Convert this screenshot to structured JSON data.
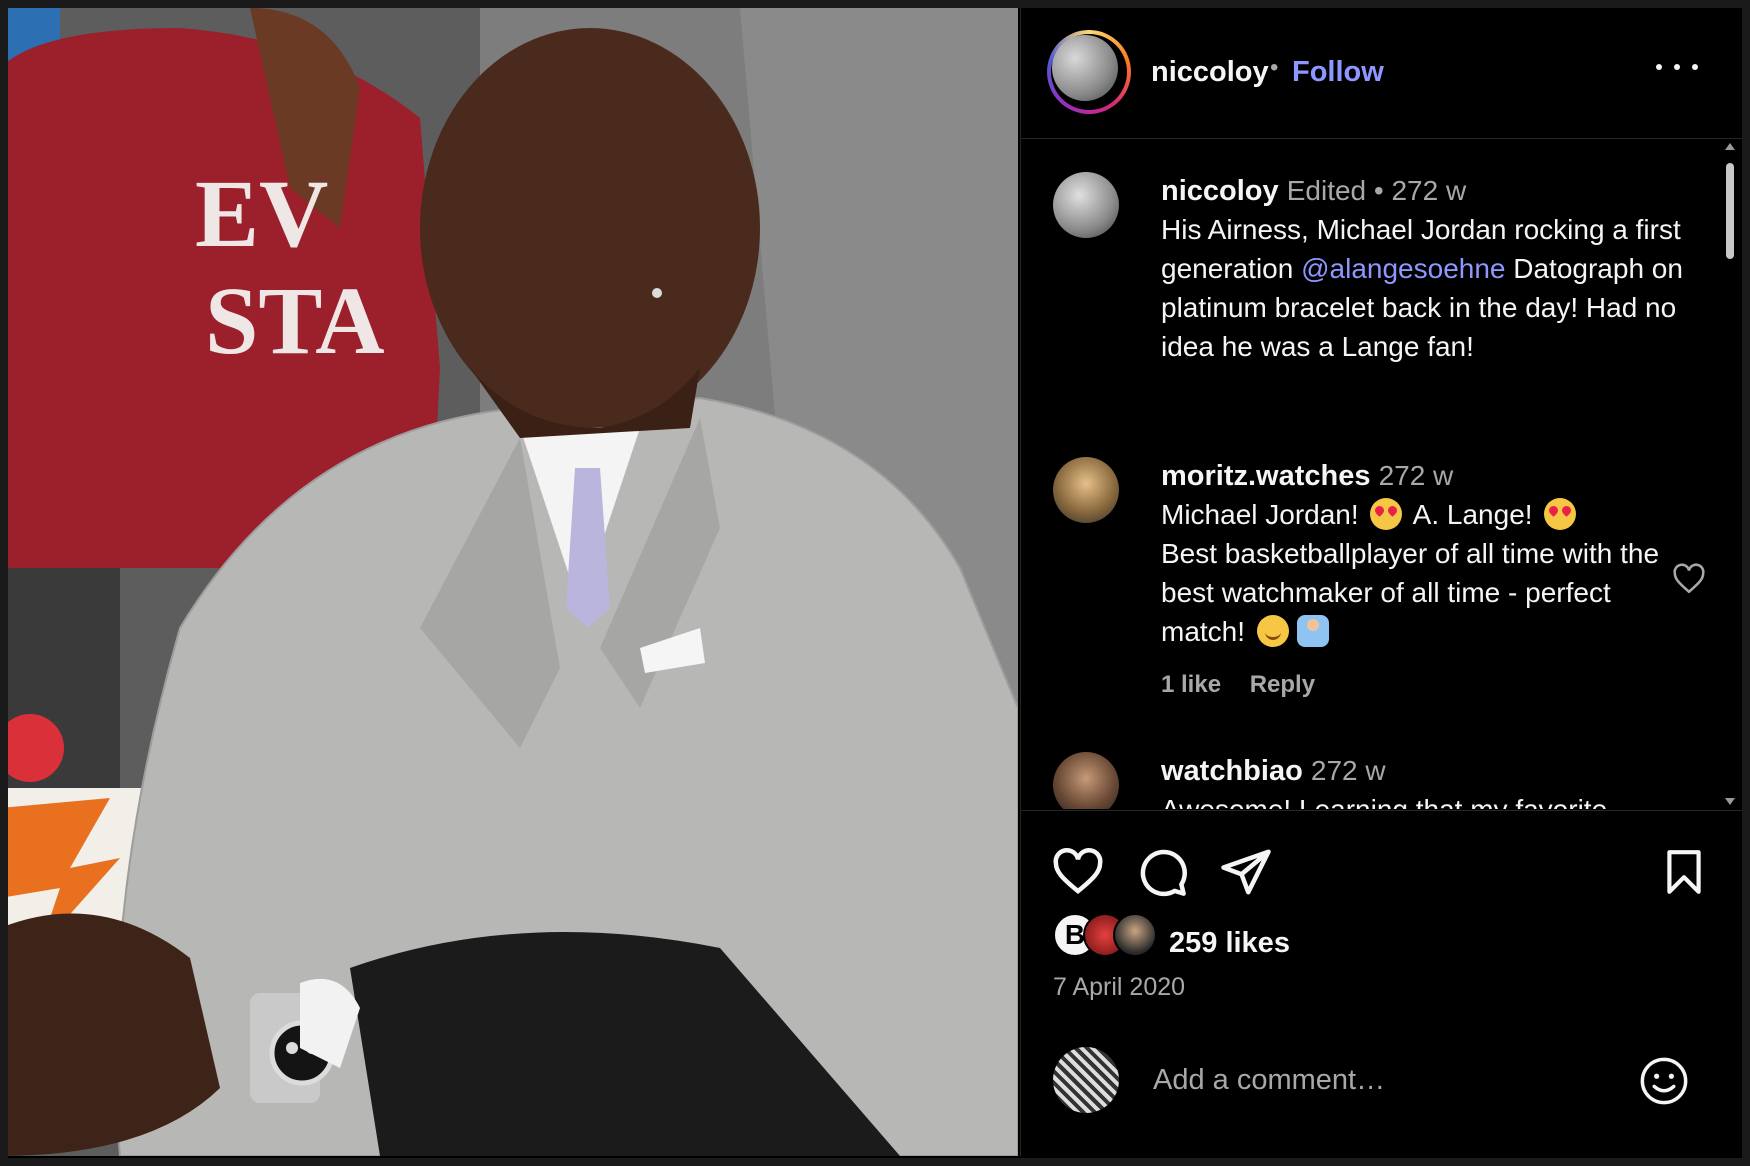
{
  "post": {
    "username": "niccoloy",
    "separator": "•",
    "follow_label": "Follow",
    "more_icon": "more-horizontal-icon"
  },
  "comments": [
    {
      "username": "niccoloy",
      "meta": "Edited •  272 w",
      "text_before": "His Airness, Michael Jordan rocking a first generation ",
      "mention": "@alangesoehne",
      "text_after": " Datograph on platinum bracelet back in the day!  Had no idea he was a Lange fan!"
    },
    {
      "username": "moritz.watches",
      "meta": "272 w",
      "part1": "Michael Jordan! ",
      "part2": " A. Lange! ",
      "part3": "Best basketballplayer of all time with the best watchmaker of all time - perfect match! ",
      "likes_label": "1 like",
      "reply_label": "Reply"
    },
    {
      "username": "watchbiao",
      "meta": "272 w",
      "text": "Awesome! Learning that my favorite"
    }
  ],
  "actions": {
    "like_icon": "heart-icon",
    "comment_icon": "comment-icon",
    "share_icon": "send-icon",
    "save_icon": "bookmark-icon"
  },
  "likes": {
    "count_label": "259 likes",
    "first_liker_initial": "B"
  },
  "date": "7 April 2020",
  "add_comment": {
    "placeholder": "Add a comment…",
    "emoji_icon": "smiley-icon"
  },
  "photo_text": {
    "jacket_line1": "EV",
    "jacket_line2": "STA"
  }
}
